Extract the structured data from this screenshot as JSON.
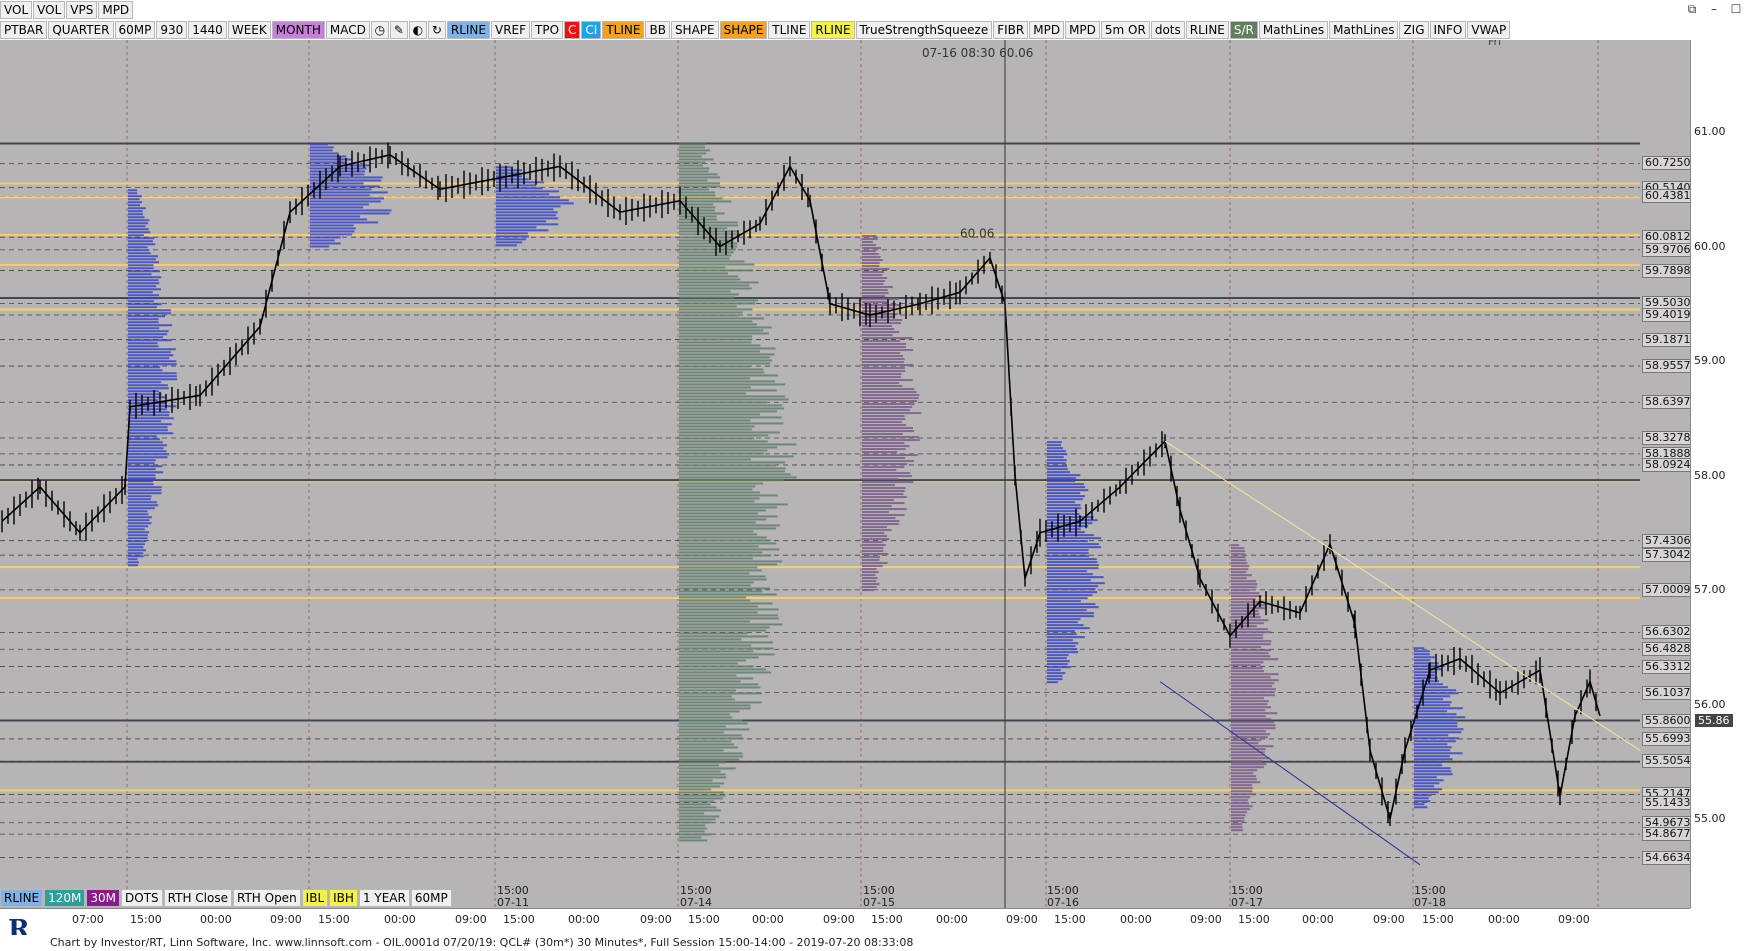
{
  "toolbar_top": [
    "VOL",
    "VOL",
    "VPS",
    "MPD"
  ],
  "toolbar_main": [
    {
      "label": "PTBAR",
      "style": ""
    },
    {
      "label": "QUARTER",
      "style": ""
    },
    {
      "label": "60MP",
      "style": ""
    },
    {
      "label": "930",
      "style": ""
    },
    {
      "label": "1440",
      "style": ""
    },
    {
      "label": "WEEK",
      "style": ""
    },
    {
      "label": "MONTH",
      "style": "active-month"
    },
    {
      "label": "MACD",
      "style": ""
    }
  ],
  "toolbar_main2": [
    {
      "label": "RLINE",
      "style": "active-blue"
    },
    {
      "label": "VREF",
      "style": ""
    },
    {
      "label": "TPO",
      "style": ""
    },
    {
      "label": "C",
      "style": "active-red"
    },
    {
      "label": "CI",
      "style": "active-cyan"
    },
    {
      "label": "TLINE",
      "style": "active-orange"
    },
    {
      "label": "BB",
      "style": ""
    },
    {
      "label": "SHAPE",
      "style": ""
    },
    {
      "label": "SHAPE",
      "style": "active-orange"
    },
    {
      "label": "TLINE",
      "style": ""
    },
    {
      "label": "RLINE",
      "style": "active-yellow"
    },
    {
      "label": "TrueStrengthSqueeze",
      "style": ""
    },
    {
      "label": "FIBR",
      "style": ""
    },
    {
      "label": "MPD",
      "style": ""
    },
    {
      "label": "MPD",
      "style": ""
    },
    {
      "label": "5m OR",
      "style": ""
    },
    {
      "label": "dots",
      "style": ""
    },
    {
      "label": "RLINE",
      "style": ""
    },
    {
      "label": "S/R",
      "style": "active-dgreen"
    },
    {
      "label": "MathLines",
      "style": ""
    },
    {
      "label": "MathLines",
      "style": ""
    },
    {
      "label": "ZIG",
      "style": ""
    },
    {
      "label": "INFO",
      "style": ""
    },
    {
      "label": "VWAP",
      "style": ""
    }
  ],
  "toolbar_bottom": [
    {
      "label": "RLINE",
      "style": "active-blue"
    },
    {
      "label": "120M",
      "style": "active-teal"
    },
    {
      "label": "30M",
      "style": "active-purple"
    },
    {
      "label": "DOTS",
      "style": ""
    },
    {
      "label": "RTH Close",
      "style": ""
    },
    {
      "label": "RTH Open",
      "style": ""
    },
    {
      "label": "IBL",
      "style": "active-yellow"
    },
    {
      "label": "IBH",
      "style": "active-yellow"
    },
    {
      "label": "1 YEAR",
      "style": ""
    },
    {
      "label": "60MP",
      "style": ""
    }
  ],
  "crosshair_label": "07-16 08:30  60.06",
  "high_marker": "60.06",
  "day_header": "Fri",
  "price_axis_ticks": [
    {
      "price": 61.0,
      "label": "61.00"
    },
    {
      "price": 60.0,
      "label": "60.00"
    },
    {
      "price": 59.0,
      "label": "59.00"
    },
    {
      "price": 58.0,
      "label": "58.00"
    },
    {
      "price": 57.0,
      "label": "57.00"
    },
    {
      "price": 56.0,
      "label": "56.00"
    },
    {
      "price": 55.0,
      "label": "55.00"
    }
  ],
  "level_labels": [
    {
      "price": 60.725,
      "label": "60.7250"
    },
    {
      "price": 60.514,
      "label": "60.5140"
    },
    {
      "price": 60.4381,
      "label": "60.4381"
    },
    {
      "price": 60.0812,
      "label": "60.0812"
    },
    {
      "price": 59.9706,
      "label": "59.9706"
    },
    {
      "price": 59.7898,
      "label": "59.7898"
    },
    {
      "price": 59.503,
      "label": "59.5030"
    },
    {
      "price": 59.4019,
      "label": "59.4019"
    },
    {
      "price": 59.1871,
      "label": "59.1871"
    },
    {
      "price": 58.9557,
      "label": "58.9557"
    },
    {
      "price": 58.6397,
      "label": "58.6397"
    },
    {
      "price": 58.3278,
      "label": "58.3278"
    },
    {
      "price": 58.1888,
      "label": "58.1888"
    },
    {
      "price": 58.0924,
      "label": "58.0924"
    },
    {
      "price": 57.4306,
      "label": "57.4306"
    },
    {
      "price": 57.3042,
      "label": "57.3042"
    },
    {
      "price": 57.0009,
      "label": "57.0009"
    },
    {
      "price": 56.6302,
      "label": "56.6302"
    },
    {
      "price": 56.4828,
      "label": "56.4828"
    },
    {
      "price": 56.3312,
      "label": "56.3312"
    },
    {
      "price": 56.1037,
      "label": "56.1037"
    },
    {
      "price": 55.86,
      "label": "55.8600"
    },
    {
      "price": 55.6993,
      "label": "55.6993"
    },
    {
      "price": 55.5054,
      "label": "55.5054"
    },
    {
      "price": 55.2147,
      "label": "55.2147"
    },
    {
      "price": 55.1433,
      "label": "55.1433"
    },
    {
      "price": 54.9673,
      "label": "54.9673"
    },
    {
      "price": 54.8677,
      "label": "54.8677"
    },
    {
      "price": 54.6634,
      "label": "54.6634"
    }
  ],
  "current_price": "55.86",
  "time_labels": [
    {
      "text": "07:00"
    },
    {
      "text": "15:00"
    },
    {
      "text": "00:00"
    },
    {
      "text": "09:00"
    },
    {
      "text": "15:00"
    },
    {
      "text": "00:00"
    },
    {
      "text": "09:00"
    },
    {
      "text": "15:00"
    },
    {
      "text": "00:00"
    },
    {
      "text": "09:00"
    },
    {
      "text": "15:00"
    },
    {
      "text": "00:00"
    },
    {
      "text": "09:00"
    },
    {
      "text": "15:00"
    },
    {
      "text": "00:00"
    },
    {
      "text": "09:00"
    },
    {
      "text": "15:00"
    },
    {
      "text": "00:00"
    },
    {
      "text": "09:00"
    },
    {
      "text": "15:00"
    },
    {
      "text": "00:00"
    },
    {
      "text": "09:00"
    },
    {
      "text": "15:00"
    },
    {
      "text": "00:00"
    },
    {
      "text": "09:00"
    }
  ],
  "session_markers": [
    {
      "time": "15:00",
      "date": "07-11"
    },
    {
      "time": "15:00",
      "date": "07-14"
    },
    {
      "time": "15:00",
      "date": "07-15"
    },
    {
      "time": "15:00",
      "date": "07-16"
    },
    {
      "time": "15:00",
      "date": "07-17"
    },
    {
      "time": "15:00",
      "date": "07-18"
    }
  ],
  "status_text": "Chart by Investor/RT, Linn Software, Inc. www.linnsoft.com - OIL.0001d   07/20/19: QCL# (30m*) 30 Minutes*, Full Session 15:00-14:00 - 2019-07-20 08:33:08",
  "colors": {
    "chart_bg": "#b6b4b4",
    "profile_blue": "#3a45c8",
    "profile_green": "#5f7f6f",
    "profile_purple": "#7a5a8a",
    "level_yellow": "#f6cf6a",
    "level_green": "#2ce02c",
    "level_dark": "#3e4a58"
  }
}
